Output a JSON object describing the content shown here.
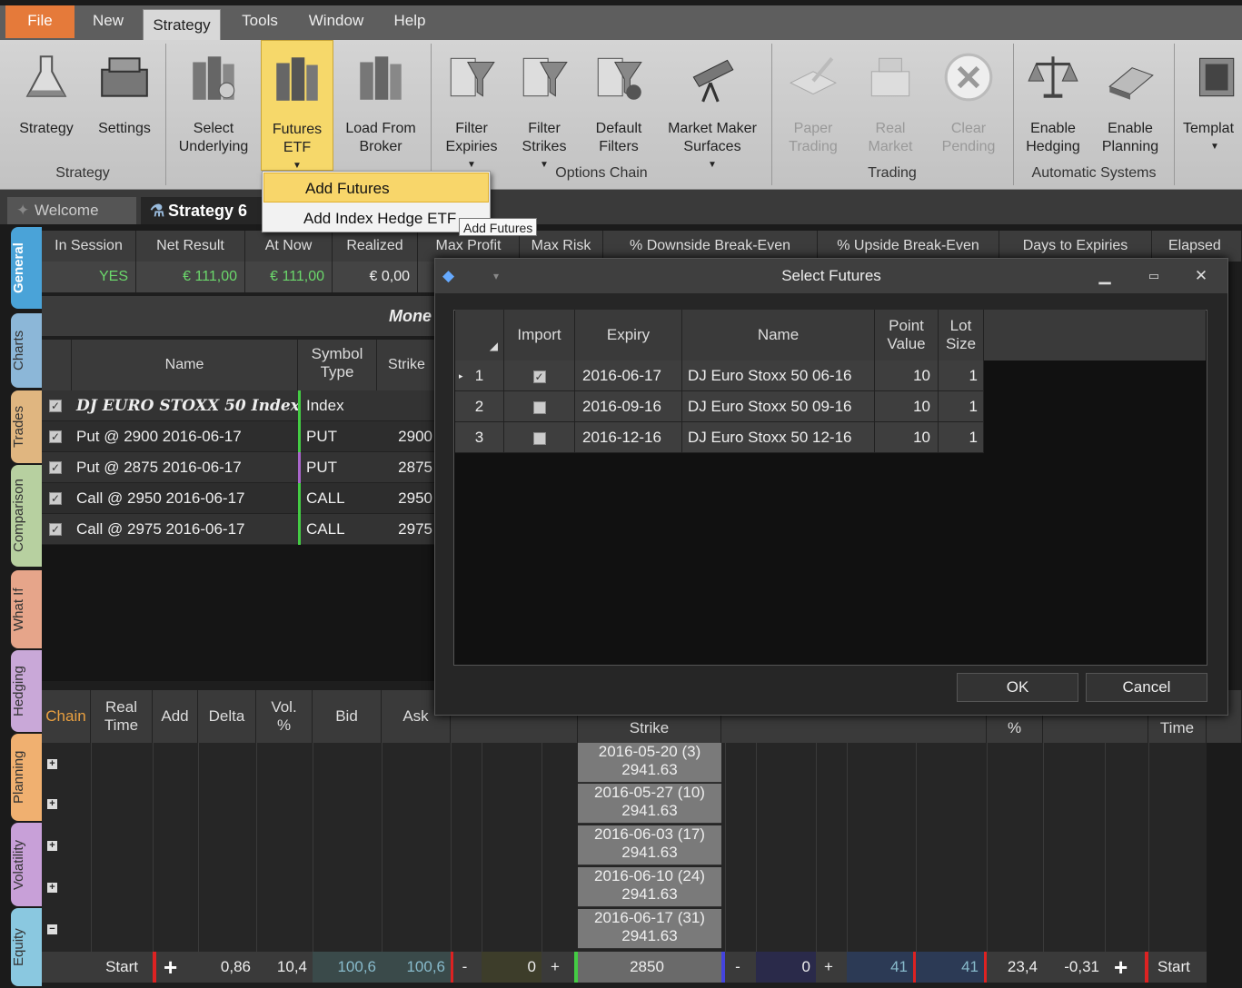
{
  "menu": {
    "file": "File",
    "new": "New",
    "strategy": "Strategy",
    "tools": "Tools",
    "window": "Window",
    "help": "Help"
  },
  "ribbon": {
    "strategy": "Strategy",
    "settings": "Settings",
    "select_underlying_1": "Select",
    "select_underlying_2": "Underlying",
    "futures_etf_1": "Futures",
    "futures_etf_2": "ETF",
    "load_broker_1": "Load From",
    "load_broker_2": "Broker",
    "filter_expiries_1": "Filter",
    "filter_expiries_2": "Expiries",
    "filter_strikes_1": "Filter",
    "filter_strikes_2": "Strikes",
    "default_filters_1": "Default",
    "default_filters_2": "Filters",
    "mm_surfaces_1": "Market Maker",
    "mm_surfaces_2": "Surfaces",
    "paper_trading_1": "Paper",
    "paper_trading_2": "Trading",
    "real_market_1": "Real",
    "real_market_2": "Market",
    "clear_pending_1": "Clear",
    "clear_pending_2": "Pending",
    "enable_hedging_1": "Enable",
    "enable_hedging_2": "Hedging",
    "enable_planning_1": "Enable",
    "enable_planning_2": "Planning",
    "templates": "Templat",
    "group_strategy": "Strategy",
    "group_options_chain": "Options Chain",
    "group_trading": "Trading",
    "group_auto": "Automatic Systems"
  },
  "dropdown": {
    "add_futures": "Add Futures",
    "add_index_hedge": "Add Index Hedge ETF",
    "tooltip": "Add Futures"
  },
  "doc_tabs": {
    "welcome": "Welcome",
    "strategy": "Strategy 6"
  },
  "side_tabs": [
    "General",
    "Charts",
    "Trades",
    "Comparison",
    "What If",
    "Hedging",
    "Planning",
    "Volatility",
    "Equity"
  ],
  "summary": {
    "headers": [
      "In Session",
      "Net Result",
      "At Now",
      "Realized",
      "Max Profit",
      "Max Risk",
      "% Downside Break-Even",
      "% Upside Break-Even",
      "Days to Expiries",
      "Elapsed Da"
    ],
    "values": [
      "YES",
      "€ 111,00",
      "€ 111,00",
      "€ 0,00"
    ]
  },
  "money_label": "Mone",
  "legs": {
    "headers": {
      "name": "Name",
      "symbol_type_1": "Symbol",
      "symbol_type_2": "Type",
      "strike": "Strike"
    },
    "rows": [
      {
        "name": "DJ EURO STOXX 50 Index",
        "type": "Index",
        "strike": ""
      },
      {
        "name": "Put @ 2900 2016-06-17",
        "type": "PUT",
        "strike": "2900"
      },
      {
        "name": "Put @ 2875 2016-06-17",
        "type": "PUT",
        "strike": "2875"
      },
      {
        "name": "Call @ 2950 2016-06-17",
        "type": "CALL",
        "strike": "2950"
      },
      {
        "name": "Call @ 2975 2016-06-17",
        "type": "CALL",
        "strike": "2975"
      }
    ]
  },
  "chain": {
    "headers": {
      "chain": "Chain",
      "real_time_1": "Real",
      "real_time_2": "Time",
      "add": "Add",
      "delta": "Delta",
      "vol_1": "Vol.",
      "vol_2": "%",
      "bid": "Bid",
      "ask": "Ask",
      "strike": "Strike",
      "pct": "%",
      "time": "Time"
    },
    "expiries": [
      {
        "date": "2016-05-20 (3)",
        "price": "2941.63"
      },
      {
        "date": "2016-05-27 (10)",
        "price": "2941.63"
      },
      {
        "date": "2016-06-03 (17)",
        "price": "2941.63"
      },
      {
        "date": "2016-06-10 (24)",
        "price": "2941.63"
      },
      {
        "date": "2016-06-17 (31)",
        "price": "2941.63"
      }
    ],
    "bottom": {
      "start_left": "Start",
      "delta": "0,86",
      "vol": "10,4",
      "bid": "100,6",
      "ask": "100,6",
      "qty_left": "0",
      "strike": "2850",
      "qty_right": "0",
      "bid_r": "41",
      "ask_r": "41",
      "pct": "23,4",
      "delta_r": "-0,31",
      "start_right": "Start",
      "minus": "-",
      "plus": "+"
    }
  },
  "dialog": {
    "title": "Select Futures",
    "headers": {
      "import": "Import",
      "expiry": "Expiry",
      "name": "Name",
      "point_value_1": "Point",
      "point_value_2": "Value",
      "lot_size_1": "Lot",
      "lot_size_2": "Size"
    },
    "rows": [
      {
        "num": "1",
        "checked": true,
        "expiry": "2016-06-17",
        "name": "DJ Euro Stoxx 50 06-16",
        "point_value": "10",
        "lot_size": "1"
      },
      {
        "num": "2",
        "checked": false,
        "expiry": "2016-09-16",
        "name": "DJ Euro Stoxx 50 09-16",
        "point_value": "10",
        "lot_size": "1"
      },
      {
        "num": "3",
        "checked": false,
        "expiry": "2016-12-16",
        "name": "DJ Euro Stoxx 50 12-16",
        "point_value": "10",
        "lot_size": "1"
      }
    ],
    "ok": "OK",
    "cancel": "Cancel"
  }
}
